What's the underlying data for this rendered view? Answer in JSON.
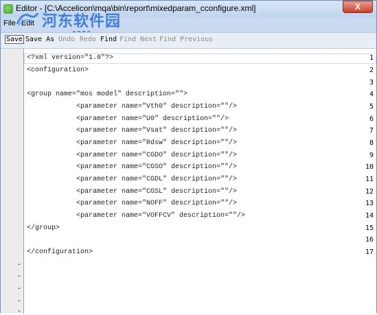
{
  "window": {
    "title_app": "Editor",
    "title_path": "-  [C:\\Accelicon\\mqa\\bin\\report\\mixedparam_cconfigure.xml]",
    "close_label": "X"
  },
  "menu": [
    "File",
    "Edit"
  ],
  "watermark": {
    "site_name": "河东软件园",
    "url": "www.pc0359.cn"
  },
  "toolbar": [
    "Save",
    "Save As",
    "Undo",
    "Redo",
    "Find",
    "Find Next",
    "Find Previous"
  ],
  "editor": {
    "lines": [
      {
        "num": "1",
        "text": "<?xml version=\"1.0\"?>"
      },
      {
        "num": "2",
        "text": "<configuration>"
      },
      {
        "num": "3",
        "text": ""
      },
      {
        "num": "4",
        "text": "<group name=\"mos model\" description=\"\">"
      },
      {
        "num": "5",
        "text": "            <parameter name=\"Vth0\" description=\"\"/>"
      },
      {
        "num": "6",
        "text": "            <parameter name=\"U0\" description=\"\"/>"
      },
      {
        "num": "7",
        "text": "            <parameter name=\"Vsat\" description=\"\"/>"
      },
      {
        "num": "8",
        "text": "            <parameter name=\"Rdsw\" description=\"\"/>"
      },
      {
        "num": "9",
        "text": "            <parameter name=\"CGDO\" description=\"\"/>"
      },
      {
        "num": "10",
        "text": "            <parameter name=\"CGSO\" description=\"\"/>"
      },
      {
        "num": "11",
        "text": "            <parameter name=\"CGDL\" description=\"\"/>"
      },
      {
        "num": "12",
        "text": "            <parameter name=\"CGSL\" description=\"\"/>"
      },
      {
        "num": "13",
        "text": "            <parameter name=\"NOFF\" description=\"\"/>"
      },
      {
        "num": "14",
        "text": "            <parameter name=\"VOFFCV\" description=\"\"/>"
      },
      {
        "num": "15",
        "text": "</group>"
      },
      {
        "num": "16",
        "text": ""
      },
      {
        "num": "17",
        "text": "</configuration>"
      }
    ],
    "empty_markers": [
      "-",
      "-",
      "-",
      "-",
      "-"
    ]
  }
}
